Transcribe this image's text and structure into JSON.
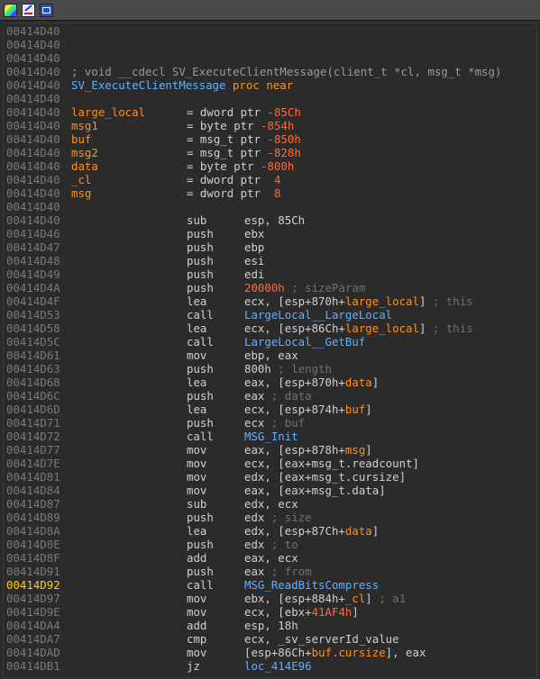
{
  "toolbar": {
    "buttons": [
      {
        "icon": "palette-icon"
      },
      {
        "icon": "edit-icon"
      },
      {
        "icon": "window-icon"
      }
    ]
  },
  "listing": {
    "lines": [
      {
        "addr": "00414D40",
        "kind": "blank"
      },
      {
        "addr": "00414D40",
        "kind": "blank"
      },
      {
        "addr": "00414D40",
        "kind": "blank"
      },
      {
        "addr": "00414D40",
        "kind": "comment",
        "text": "; void __cdecl SV_ExecuteClientMessage(client_t *cl, msg_t *msg)"
      },
      {
        "addr": "00414D40",
        "kind": "proc",
        "label": "SV_ExecuteClientMessage",
        "proc": "proc near"
      },
      {
        "addr": "00414D40",
        "kind": "blank"
      },
      {
        "addr": "00414D40",
        "kind": "var",
        "name": "large_local",
        "decl": "= dword ptr ",
        "value": "-85Ch"
      },
      {
        "addr": "00414D40",
        "kind": "var",
        "name": "msg1",
        "decl": "= byte ptr ",
        "value": "-854h"
      },
      {
        "addr": "00414D40",
        "kind": "var",
        "name": "buf",
        "decl": "= msg_t ptr ",
        "value": "-850h"
      },
      {
        "addr": "00414D40",
        "kind": "var",
        "name": "msg2",
        "decl": "= msg_t ptr ",
        "value": "-828h"
      },
      {
        "addr": "00414D40",
        "kind": "var",
        "name": "data",
        "decl": "= byte ptr ",
        "value": "-800h"
      },
      {
        "addr": "00414D40",
        "kind": "var",
        "name": "_cl",
        "decl": "= dword ptr  ",
        "value": "4"
      },
      {
        "addr": "00414D40",
        "kind": "var",
        "name": "msg",
        "decl": "= dword ptr  ",
        "value": "8"
      },
      {
        "addr": "00414D40",
        "kind": "blank"
      },
      {
        "addr": "00414D40",
        "kind": "ins",
        "mnem": "sub",
        "ops": [
          {
            "t": "esp, 85Ch",
            "c": "reg"
          }
        ]
      },
      {
        "addr": "00414D46",
        "kind": "ins",
        "mnem": "push",
        "ops": [
          {
            "t": "ebx",
            "c": "reg"
          }
        ]
      },
      {
        "addr": "00414D47",
        "kind": "ins",
        "mnem": "push",
        "ops": [
          {
            "t": "ebp",
            "c": "reg"
          }
        ]
      },
      {
        "addr": "00414D48",
        "kind": "ins",
        "mnem": "push",
        "ops": [
          {
            "t": "esi",
            "c": "reg"
          }
        ]
      },
      {
        "addr": "00414D49",
        "kind": "ins",
        "mnem": "push",
        "ops": [
          {
            "t": "edi",
            "c": "reg"
          }
        ]
      },
      {
        "addr": "00414D4A",
        "kind": "ins",
        "mnem": "push",
        "ops": [
          {
            "t": "20000h",
            "c": "num"
          },
          {
            "t": " ; sizeParam",
            "c": "cmt"
          }
        ]
      },
      {
        "addr": "00414D4F",
        "kind": "ins",
        "mnem": "lea",
        "ops": [
          {
            "t": "ecx, [esp+870h+",
            "c": "reg"
          },
          {
            "t": "large_local",
            "c": "var"
          },
          {
            "t": "]",
            "c": "reg"
          },
          {
            "t": " ; this",
            "c": "cmt"
          }
        ]
      },
      {
        "addr": "00414D53",
        "kind": "ins",
        "mnem": "call",
        "ops": [
          {
            "t": "LargeLocal__LargeLocal",
            "c": "fn"
          }
        ]
      },
      {
        "addr": "00414D58",
        "kind": "ins",
        "mnem": "lea",
        "ops": [
          {
            "t": "ecx, [esp+86Ch+",
            "c": "reg"
          },
          {
            "t": "large_local",
            "c": "var"
          },
          {
            "t": "]",
            "c": "reg"
          },
          {
            "t": " ; this",
            "c": "cmt"
          }
        ]
      },
      {
        "addr": "00414D5C",
        "kind": "ins",
        "mnem": "call",
        "ops": [
          {
            "t": "LargeLocal__GetBuf",
            "c": "fn"
          }
        ]
      },
      {
        "addr": "00414D61",
        "kind": "ins",
        "mnem": "mov",
        "ops": [
          {
            "t": "ebp, eax",
            "c": "reg"
          }
        ]
      },
      {
        "addr": "00414D63",
        "kind": "ins",
        "mnem": "push",
        "ops": [
          {
            "t": "800h",
            "c": "reg"
          },
          {
            "t": " ; length",
            "c": "cmt"
          }
        ]
      },
      {
        "addr": "00414D68",
        "kind": "ins",
        "mnem": "lea",
        "ops": [
          {
            "t": "eax, [esp+870h+",
            "c": "reg"
          },
          {
            "t": "data",
            "c": "var"
          },
          {
            "t": "]",
            "c": "reg"
          }
        ]
      },
      {
        "addr": "00414D6C",
        "kind": "ins",
        "mnem": "push",
        "ops": [
          {
            "t": "eax",
            "c": "reg"
          },
          {
            "t": " ; data",
            "c": "cmt"
          }
        ]
      },
      {
        "addr": "00414D6D",
        "kind": "ins",
        "mnem": "lea",
        "ops": [
          {
            "t": "ecx, [esp+874h+",
            "c": "reg"
          },
          {
            "t": "buf",
            "c": "var"
          },
          {
            "t": "]",
            "c": "reg"
          }
        ]
      },
      {
        "addr": "00414D71",
        "kind": "ins",
        "mnem": "push",
        "ops": [
          {
            "t": "ecx",
            "c": "reg"
          },
          {
            "t": " ; buf",
            "c": "cmt"
          }
        ]
      },
      {
        "addr": "00414D72",
        "kind": "ins",
        "mnem": "call",
        "ops": [
          {
            "t": "MSG_Init",
            "c": "fn"
          }
        ]
      },
      {
        "addr": "00414D77",
        "kind": "ins",
        "mnem": "mov",
        "ops": [
          {
            "t": "eax, [esp+878h+",
            "c": "reg"
          },
          {
            "t": "msg",
            "c": "var"
          },
          {
            "t": "]",
            "c": "reg"
          }
        ]
      },
      {
        "addr": "00414D7E",
        "kind": "ins",
        "mnem": "mov",
        "ops": [
          {
            "t": "ecx, [eax+msg_t.readcount]",
            "c": "reg"
          }
        ]
      },
      {
        "addr": "00414D81",
        "kind": "ins",
        "mnem": "mov",
        "ops": [
          {
            "t": "edx, [eax+msg_t.cursize]",
            "c": "reg"
          }
        ]
      },
      {
        "addr": "00414D84",
        "kind": "ins",
        "mnem": "mov",
        "ops": [
          {
            "t": "eax, [eax+msg_t.data]",
            "c": "reg"
          }
        ]
      },
      {
        "addr": "00414D87",
        "kind": "ins",
        "mnem": "sub",
        "ops": [
          {
            "t": "edx, ecx",
            "c": "reg"
          }
        ]
      },
      {
        "addr": "00414D89",
        "kind": "ins",
        "mnem": "push",
        "ops": [
          {
            "t": "edx",
            "c": "reg"
          },
          {
            "t": " ; size",
            "c": "cmt"
          }
        ]
      },
      {
        "addr": "00414D8A",
        "kind": "ins",
        "mnem": "lea",
        "ops": [
          {
            "t": "edx, [esp+87Ch+",
            "c": "reg"
          },
          {
            "t": "data",
            "c": "var"
          },
          {
            "t": "]",
            "c": "reg"
          }
        ]
      },
      {
        "addr": "00414D8E",
        "kind": "ins",
        "mnem": "push",
        "ops": [
          {
            "t": "edx",
            "c": "reg"
          },
          {
            "t": " ; to",
            "c": "cmt"
          }
        ]
      },
      {
        "addr": "00414D8F",
        "kind": "ins",
        "mnem": "add",
        "ops": [
          {
            "t": "eax, ecx",
            "c": "reg"
          }
        ]
      },
      {
        "addr": "00414D91",
        "kind": "ins",
        "mnem": "push",
        "ops": [
          {
            "t": "eax",
            "c": "reg"
          },
          {
            "t": " ; from",
            "c": "cmt"
          }
        ]
      },
      {
        "addr": "00414D92",
        "kind": "ins",
        "highlight": true,
        "mnem": "call",
        "ops": [
          {
            "t": "MSG_ReadBitsCompress",
            "c": "fn"
          }
        ]
      },
      {
        "addr": "00414D97",
        "kind": "ins",
        "mnem": "mov",
        "ops": [
          {
            "t": "ebx, [esp+884h+",
            "c": "reg"
          },
          {
            "t": "_cl",
            "c": "var"
          },
          {
            "t": "]",
            "c": "reg"
          },
          {
            "t": " ; a1",
            "c": "cmt"
          }
        ]
      },
      {
        "addr": "00414D9E",
        "kind": "ins",
        "mnem": "mov",
        "ops": [
          {
            "t": "ecx, [ebx+",
            "c": "reg"
          },
          {
            "t": "41AF4h",
            "c": "num"
          },
          {
            "t": "]",
            "c": "reg"
          }
        ]
      },
      {
        "addr": "00414DA4",
        "kind": "ins",
        "mnem": "add",
        "ops": [
          {
            "t": "esp, 18h",
            "c": "reg"
          }
        ]
      },
      {
        "addr": "00414DA7",
        "kind": "ins",
        "mnem": "cmp",
        "ops": [
          {
            "t": "ecx, _sv_serverId_value",
            "c": "reg"
          }
        ]
      },
      {
        "addr": "00414DAD",
        "kind": "ins",
        "mnem": "mov",
        "ops": [
          {
            "t": "[esp+86Ch+",
            "c": "reg"
          },
          {
            "t": "buf.cursize",
            "c": "var"
          },
          {
            "t": "], eax",
            "c": "reg"
          }
        ]
      },
      {
        "addr": "00414DB1",
        "kind": "ins",
        "mnem": "jz",
        "ops": [
          {
            "t": "loc_414E96",
            "c": "fn"
          }
        ]
      }
    ]
  }
}
